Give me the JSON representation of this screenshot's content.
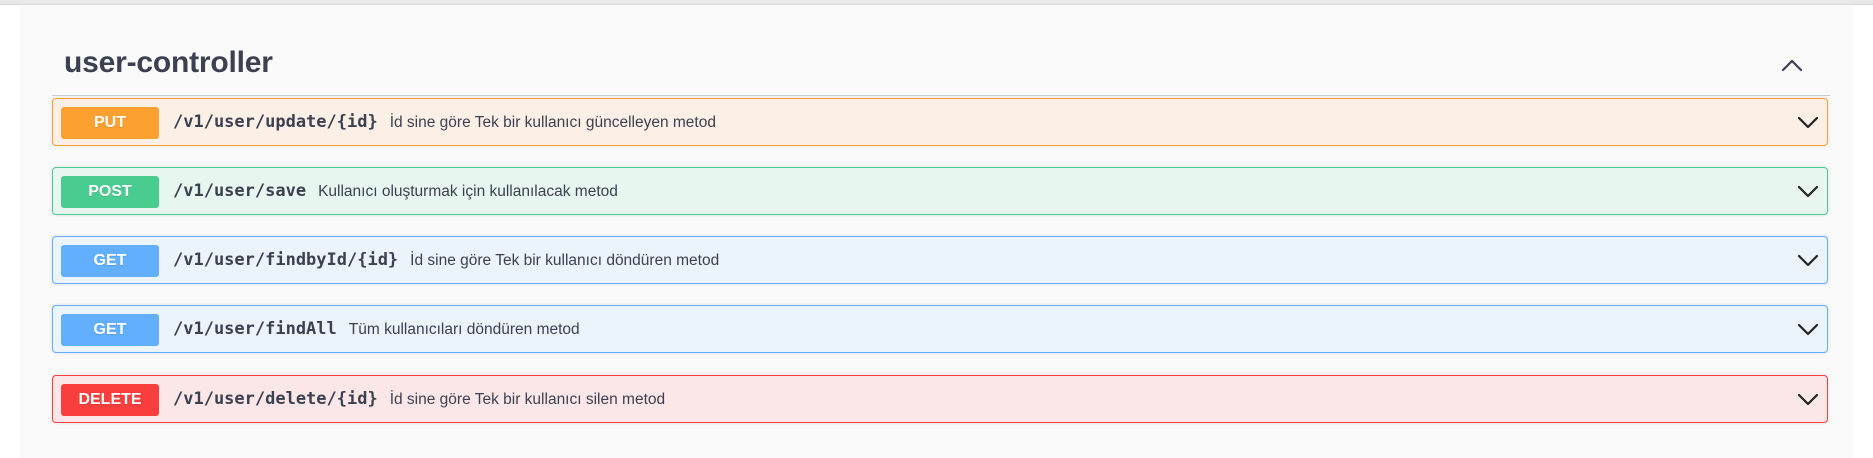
{
  "tag": {
    "title": "user-controller",
    "collapse_icon": "chevron-up-icon"
  },
  "operations": [
    {
      "method": "PUT",
      "path": "/v1/user/update/{id}",
      "summary": "İd sine göre Tek bir kullanıcı güncelleyen metod",
      "color": "#fca130",
      "expand_icon": "chevron-down-icon"
    },
    {
      "method": "POST",
      "path": "/v1/user/save",
      "summary": "Kullanıcı oluşturmak için kullanılacak metod",
      "color": "#49cc90",
      "expand_icon": "chevron-down-icon"
    },
    {
      "method": "GET",
      "path": "/v1/user/findbyId/{id}",
      "summary": "İd sine göre Tek bir kullanıcı döndüren metod",
      "color": "#61affe",
      "expand_icon": "chevron-down-icon"
    },
    {
      "method": "GET",
      "path": "/v1/user/findAll",
      "summary": "Tüm kullanıcıları döndüren metod",
      "color": "#61affe",
      "expand_icon": "chevron-down-icon"
    },
    {
      "method": "DELETE",
      "path": "/v1/user/delete/{id}",
      "summary": "İd sine göre Tek bir kullanıcı silen metod",
      "color": "#f93e3e",
      "expand_icon": "chevron-down-icon"
    }
  ]
}
